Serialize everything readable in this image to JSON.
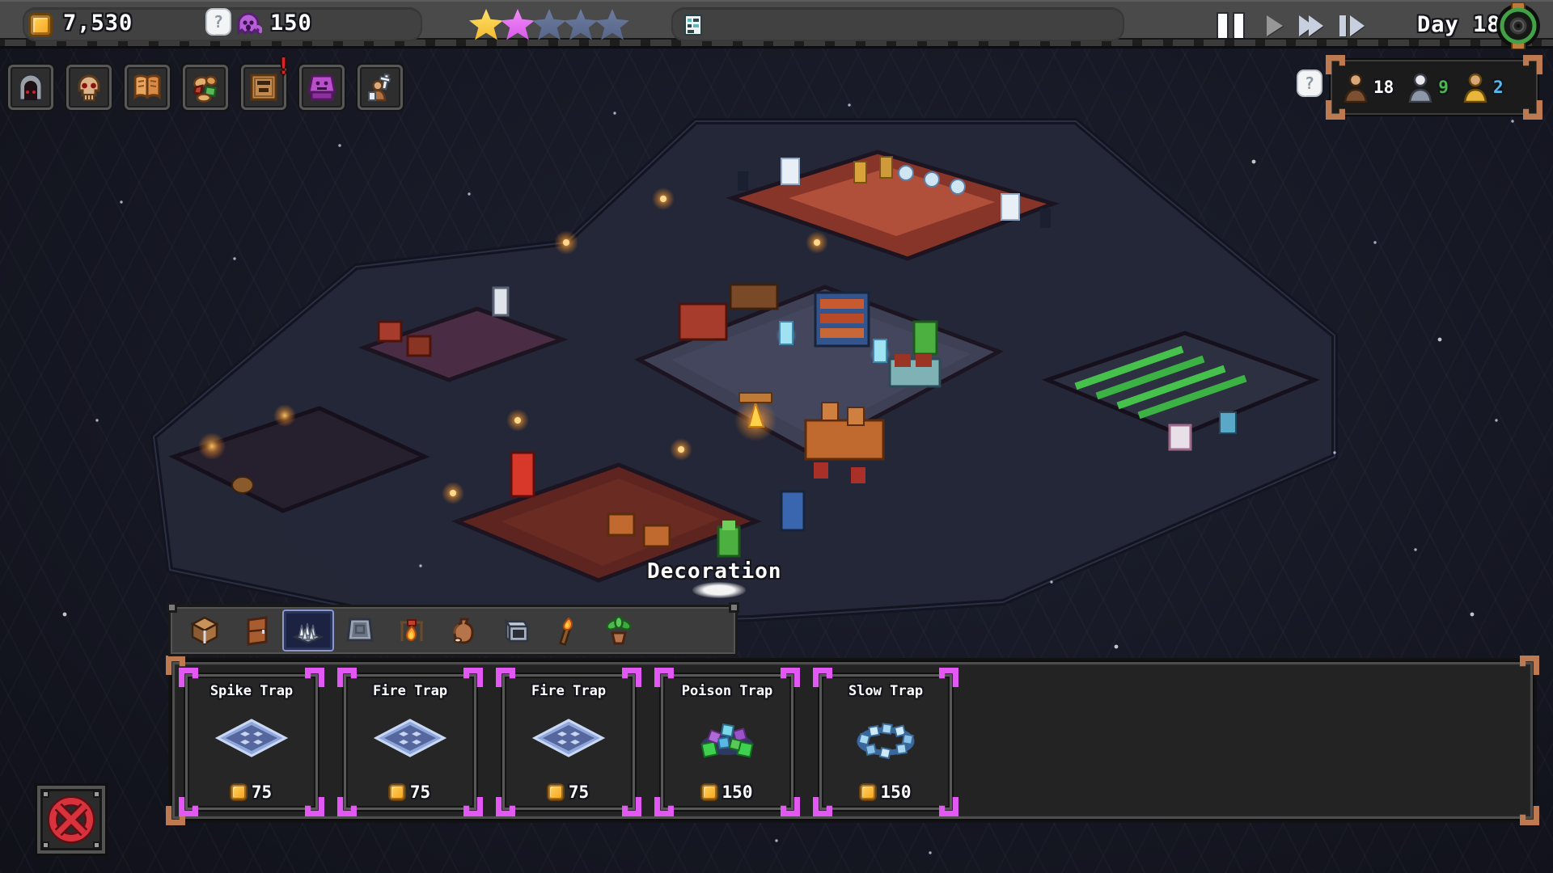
{
  "top_bar": {
    "gold_value": "7,530",
    "souls_value": "150",
    "souls_bubble_text": "?",
    "rating_classes": [
      "star gold",
      "star pink",
      "star dim",
      "star dim",
      "star dim"
    ],
    "day_label": "Day 18"
  },
  "toolbar": {
    "buttons": [
      {
        "name": "dungeon-gate"
      },
      {
        "name": "skull"
      },
      {
        "name": "book"
      },
      {
        "name": "supplies"
      },
      {
        "name": "notice-sign",
        "badge": "!"
      },
      {
        "name": "altar"
      },
      {
        "name": "hero-statue"
      }
    ]
  },
  "population": {
    "bubble_text": "?",
    "entries": [
      {
        "name": "workers",
        "count": "18",
        "count_style": "color:#ffffff"
      },
      {
        "name": "elders",
        "count": "9",
        "count_style": "color:#4cb551"
      },
      {
        "name": "heroes",
        "count": "2",
        "count_style": "color:#58bbee"
      }
    ]
  },
  "scene": {
    "tooltip": "Decoration"
  },
  "build_menu": {
    "tabs": [
      {
        "name": "crate",
        "cls": "tab"
      },
      {
        "name": "door",
        "cls": "tab"
      },
      {
        "name": "spike-trap",
        "cls": "tab selected"
      },
      {
        "name": "pressure-plate",
        "cls": "tab"
      },
      {
        "name": "campfire",
        "cls": "tab"
      },
      {
        "name": "jug",
        "cls": "tab"
      },
      {
        "name": "forge",
        "cls": "tab"
      },
      {
        "name": "torch",
        "cls": "tab"
      },
      {
        "name": "plant",
        "cls": "tab"
      }
    ],
    "cards": [
      {
        "title": "Spike Trap",
        "cost": "75",
        "icon": "trap-plate"
      },
      {
        "title": "Fire Trap",
        "cost": "75",
        "icon": "trap-plate"
      },
      {
        "title": "Fire Trap",
        "cost": "75",
        "icon": "trap-plate"
      },
      {
        "title": "Poison Trap",
        "cost": "150",
        "icon": "poison-crystals"
      },
      {
        "title": "Slow Trap",
        "cost": "150",
        "icon": "ice-crystal-ring"
      }
    ]
  },
  "colors": {
    "accent_magenta": "#e158f2",
    "accent_copper": "#bd7a50",
    "gold": "#f6b21d",
    "star_gold": "#f2c83a",
    "star_pink": "#e06cf2",
    "star_empty": "#5c6c90",
    "count_green": "#4cb551",
    "count_blue": "#58bbee"
  }
}
